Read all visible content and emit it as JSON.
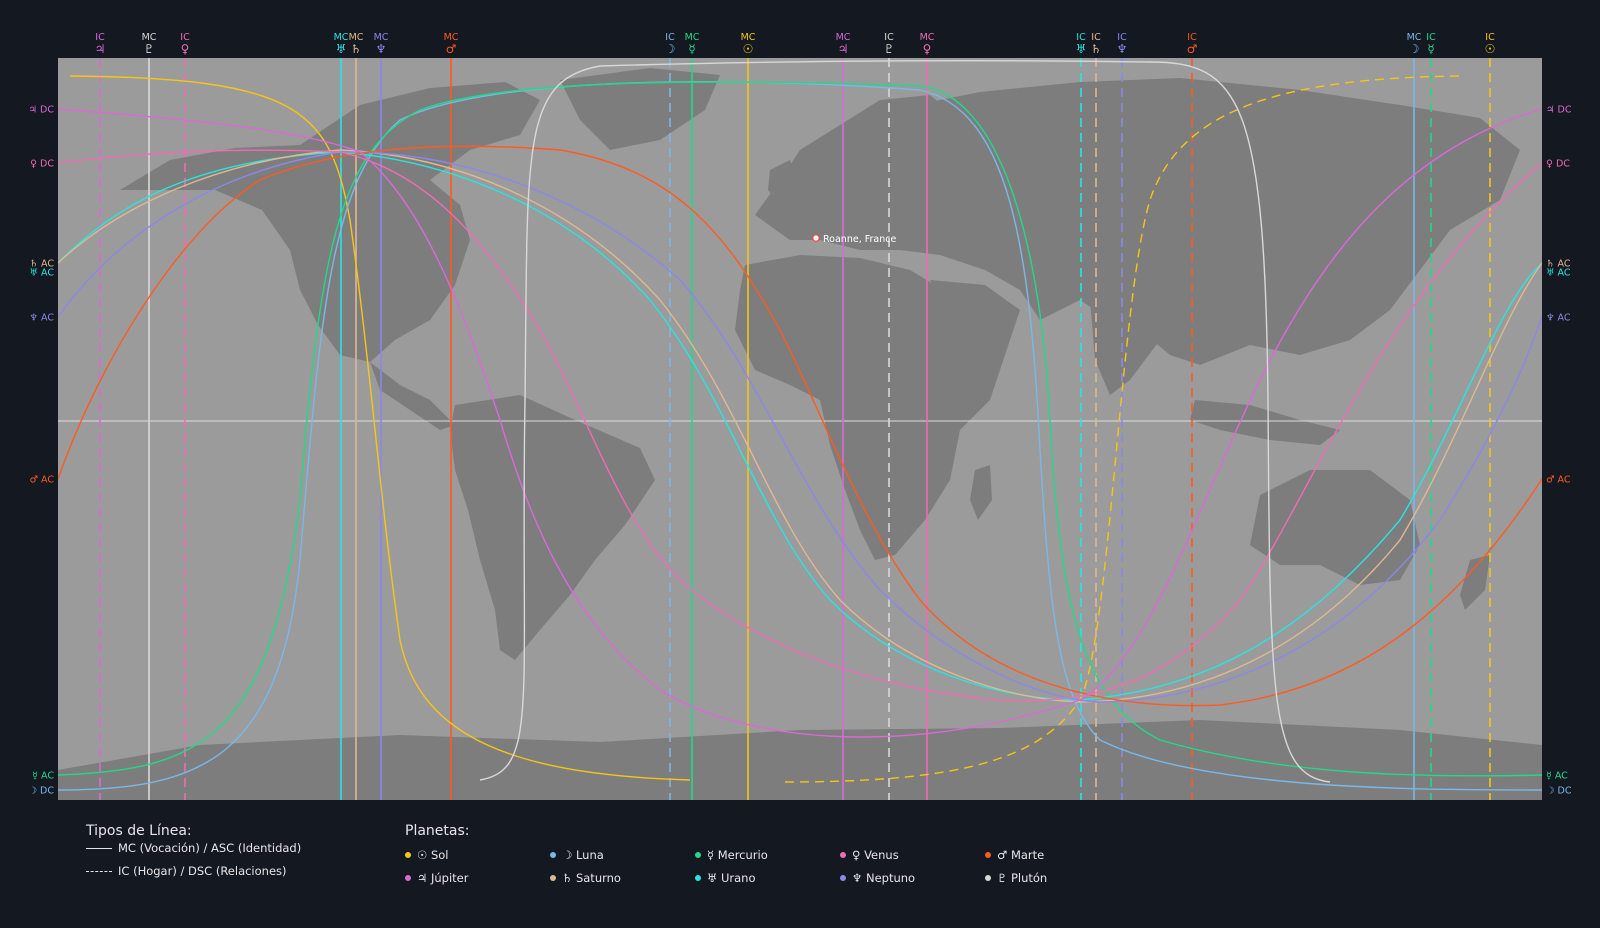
{
  "title": "",
  "location": {
    "label": "Roanne, France"
  },
  "map": {
    "background": "#9b9b9b",
    "land": "#7d7d7d",
    "equator": "#dcdcdc"
  },
  "planets": [
    {
      "key": "sol",
      "glyph": "☉",
      "name": "Sol",
      "color": "#f5c518"
    },
    {
      "key": "luna",
      "glyph": "☽",
      "name": "Luna",
      "color": "#7ab8e8"
    },
    {
      "key": "mercurio",
      "glyph": "☿",
      "name": "Mercurio",
      "color": "#22d98a"
    },
    {
      "key": "venus",
      "glyph": "♀",
      "name": "Venus",
      "color": "#f06cb4"
    },
    {
      "key": "marte",
      "glyph": "♂",
      "name": "Marte",
      "color": "#ff5a1f"
    },
    {
      "key": "jupiter",
      "glyph": "♃",
      "name": "Júpiter",
      "color": "#d96ad6"
    },
    {
      "key": "saturno",
      "glyph": "♄",
      "name": "Saturno",
      "color": "#e0b890"
    },
    {
      "key": "urano",
      "glyph": "♅",
      "name": "Urano",
      "color": "#27e6e0"
    },
    {
      "key": "neptuno",
      "glyph": "♆",
      "name": "Neptuno",
      "color": "#8a88e8"
    },
    {
      "key": "pluton",
      "glyph": "♇",
      "name": "Plutón",
      "color": "#d8d8d8"
    }
  ],
  "legend": {
    "line_types_title": "Tipos de Línea:",
    "solid_label": "MC (Vocación) / ASC (Identidad)",
    "dashed_label": "IC (Hogar) / DSC (Relaciones)",
    "planets_title": "Planetas:"
  },
  "top_labels": [
    {
      "kind": "IC",
      "planet": "jupiter"
    },
    {
      "kind": "MC",
      "planet": "pluton"
    },
    {
      "kind": "IC",
      "planet": "venus"
    },
    {
      "kind": "MC",
      "planet": "urano"
    },
    {
      "kind": "MC",
      "planet": "saturno"
    },
    {
      "kind": "MC",
      "planet": "neptuno"
    },
    {
      "kind": "MC",
      "planet": "marte"
    },
    {
      "kind": "IC",
      "planet": "luna"
    },
    {
      "kind": "MC",
      "planet": "mercurio"
    },
    {
      "kind": "MC",
      "planet": "sol"
    },
    {
      "kind": "MC",
      "planet": "jupiter"
    },
    {
      "kind": "IC",
      "planet": "pluton"
    },
    {
      "kind": "MC",
      "planet": "venus"
    },
    {
      "kind": "IC",
      "planet": "urano"
    },
    {
      "kind": "IC",
      "planet": "saturno"
    },
    {
      "kind": "IC",
      "planet": "neptuno"
    },
    {
      "kind": "IC",
      "planet": "marte"
    },
    {
      "kind": "MC",
      "planet": "luna"
    },
    {
      "kind": "IC",
      "planet": "mercurio"
    },
    {
      "kind": "IC",
      "planet": "sol"
    }
  ],
  "side_labels": [
    {
      "kind": "DC",
      "planet": "jupiter"
    },
    {
      "kind": "DC",
      "planet": "venus"
    },
    {
      "kind": "AC",
      "planet": "saturno"
    },
    {
      "kind": "AC",
      "planet": "urano"
    },
    {
      "kind": "AC",
      "planet": "neptuno"
    },
    {
      "kind": "AC",
      "planet": "marte"
    },
    {
      "kind": "AC",
      "planet": "mercurio"
    },
    {
      "kind": "DC",
      "planet": "luna"
    }
  ]
}
